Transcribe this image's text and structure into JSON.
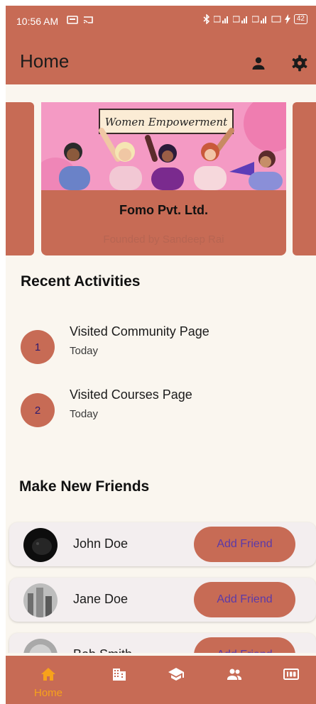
{
  "status_bar": {
    "time": "10:56 AM",
    "battery": "42"
  },
  "app_bar": {
    "title": "Home",
    "actions": [
      "person-icon",
      "gear-icon"
    ]
  },
  "carousel": {
    "card": {
      "banner_text": "Women Empowerment",
      "company": "Fomo Pvt. Ltd.",
      "founder": "Founded by Sandeep Rai"
    }
  },
  "recent_activities": {
    "heading": "Recent Activities",
    "items": [
      {
        "num": "1",
        "title": "Visited Community Page",
        "time": "Today"
      },
      {
        "num": "2",
        "title": "Visited Courses Page",
        "time": "Today"
      }
    ]
  },
  "friends": {
    "heading": "Make New Friends",
    "button_label": "Add Friend",
    "items": [
      {
        "name": "John Doe"
      },
      {
        "name": "Jane Doe"
      },
      {
        "name": "Bob Smith"
      }
    ]
  },
  "bottom_nav": {
    "active": "Home",
    "items": [
      {
        "label": "Home",
        "icon": "home-icon"
      },
      {
        "icon": "business-icon"
      },
      {
        "icon": "school-icon"
      },
      {
        "icon": "people-icon"
      },
      {
        "icon": "dashboard-icon"
      }
    ]
  },
  "colors": {
    "primary": "#c76b55",
    "background": "#faf6ef",
    "active_nav": "#f7a21b",
    "button_text": "#5b3aa8"
  }
}
